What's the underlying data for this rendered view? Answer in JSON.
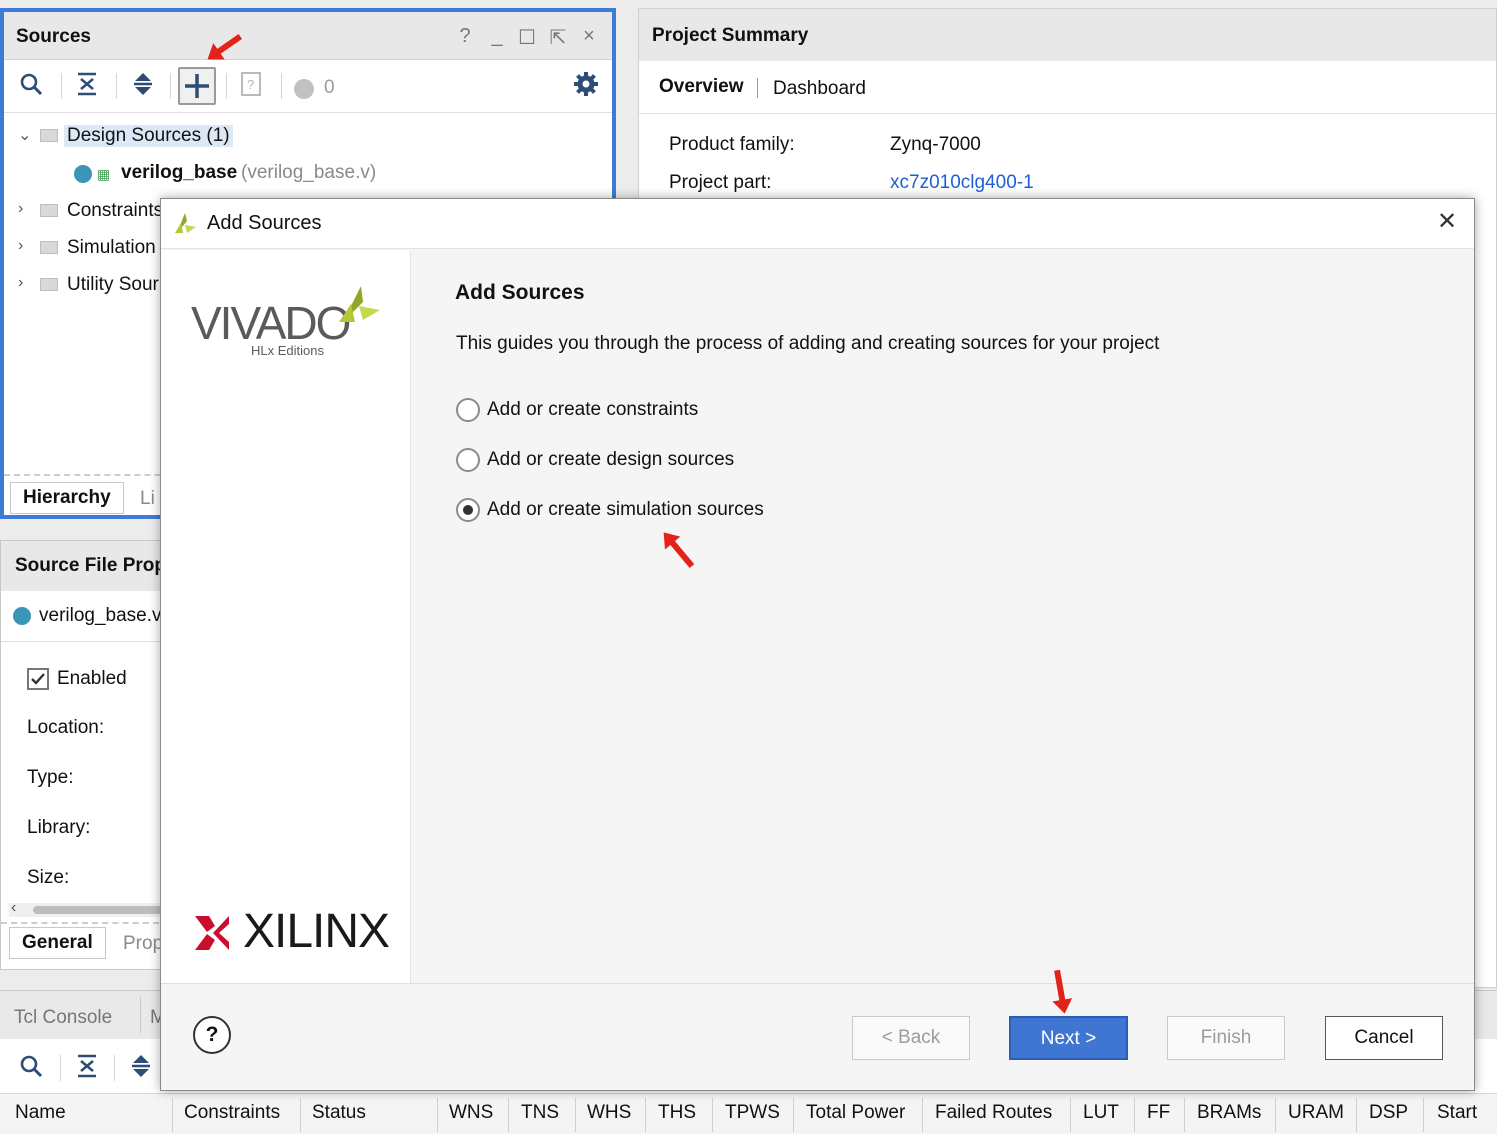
{
  "sources": {
    "title": "Sources",
    "controls": [
      "?",
      "_",
      "☐",
      "⇱",
      "×"
    ],
    "toolbar_count": "0",
    "tree": {
      "design_sources": "Design Sources (1)",
      "verilog_base_name": "verilog_base",
      "verilog_base_file": "(verilog_base.v)",
      "constraints": "Constraints",
      "simulation": "Simulation",
      "utility": "Utility Sour"
    },
    "tabs": {
      "hierarchy": "Hierarchy",
      "libraries": "Li"
    }
  },
  "props": {
    "title": "Source File Prop",
    "file": "verilog_base.v",
    "enabled_label": "Enabled",
    "location_label": "Location:",
    "type_label": "Type:",
    "library_label": "Library:",
    "size_label": "Size:",
    "tabs": {
      "general": "General",
      "properties": "Prop"
    }
  },
  "tcl": {
    "tab_label": "Tcl Console",
    "tab2": "M",
    "columns": [
      "Name",
      "Constraints",
      "Status",
      "WNS",
      "TNS",
      "WHS",
      "THS",
      "TPWS",
      "Total Power",
      "Failed Routes",
      "LUT",
      "FF",
      "BRAMs",
      "URAM",
      "DSP",
      "Start"
    ]
  },
  "summary": {
    "title": "Project Summary",
    "tabs": {
      "overview": "Overview",
      "dashboard": "Dashboard"
    },
    "product_family_label": "Product family:",
    "product_family_value": "Zynq-7000",
    "project_part_label": "Project part:",
    "project_part_value": "xc7z010clg400-1"
  },
  "dialog": {
    "title": "Add Sources",
    "close": "✕",
    "logo_vivado": "VIVADO",
    "logo_edition": "HLx Editions",
    "logo_xilinx": "XILINX",
    "heading": "Add Sources",
    "description": "This guides you through the process of adding and creating sources for your project",
    "options": [
      {
        "label": "Add or create constraints",
        "selected": false
      },
      {
        "label": "Add or create design sources",
        "selected": false
      },
      {
        "label": "Add or create simulation sources",
        "selected": true
      }
    ],
    "buttons": {
      "help": "?",
      "back": "< Back",
      "next": "Next >",
      "finish": "Finish",
      "cancel": "Cancel"
    }
  },
  "colors": {
    "accent": "#3e76d2",
    "panel_border": "#3f7bd6",
    "link": "#1f5fd6",
    "annotation_arrow": "#e3231a",
    "xilinx_red": "#c8102e",
    "vivado_green": "#b5c734"
  }
}
